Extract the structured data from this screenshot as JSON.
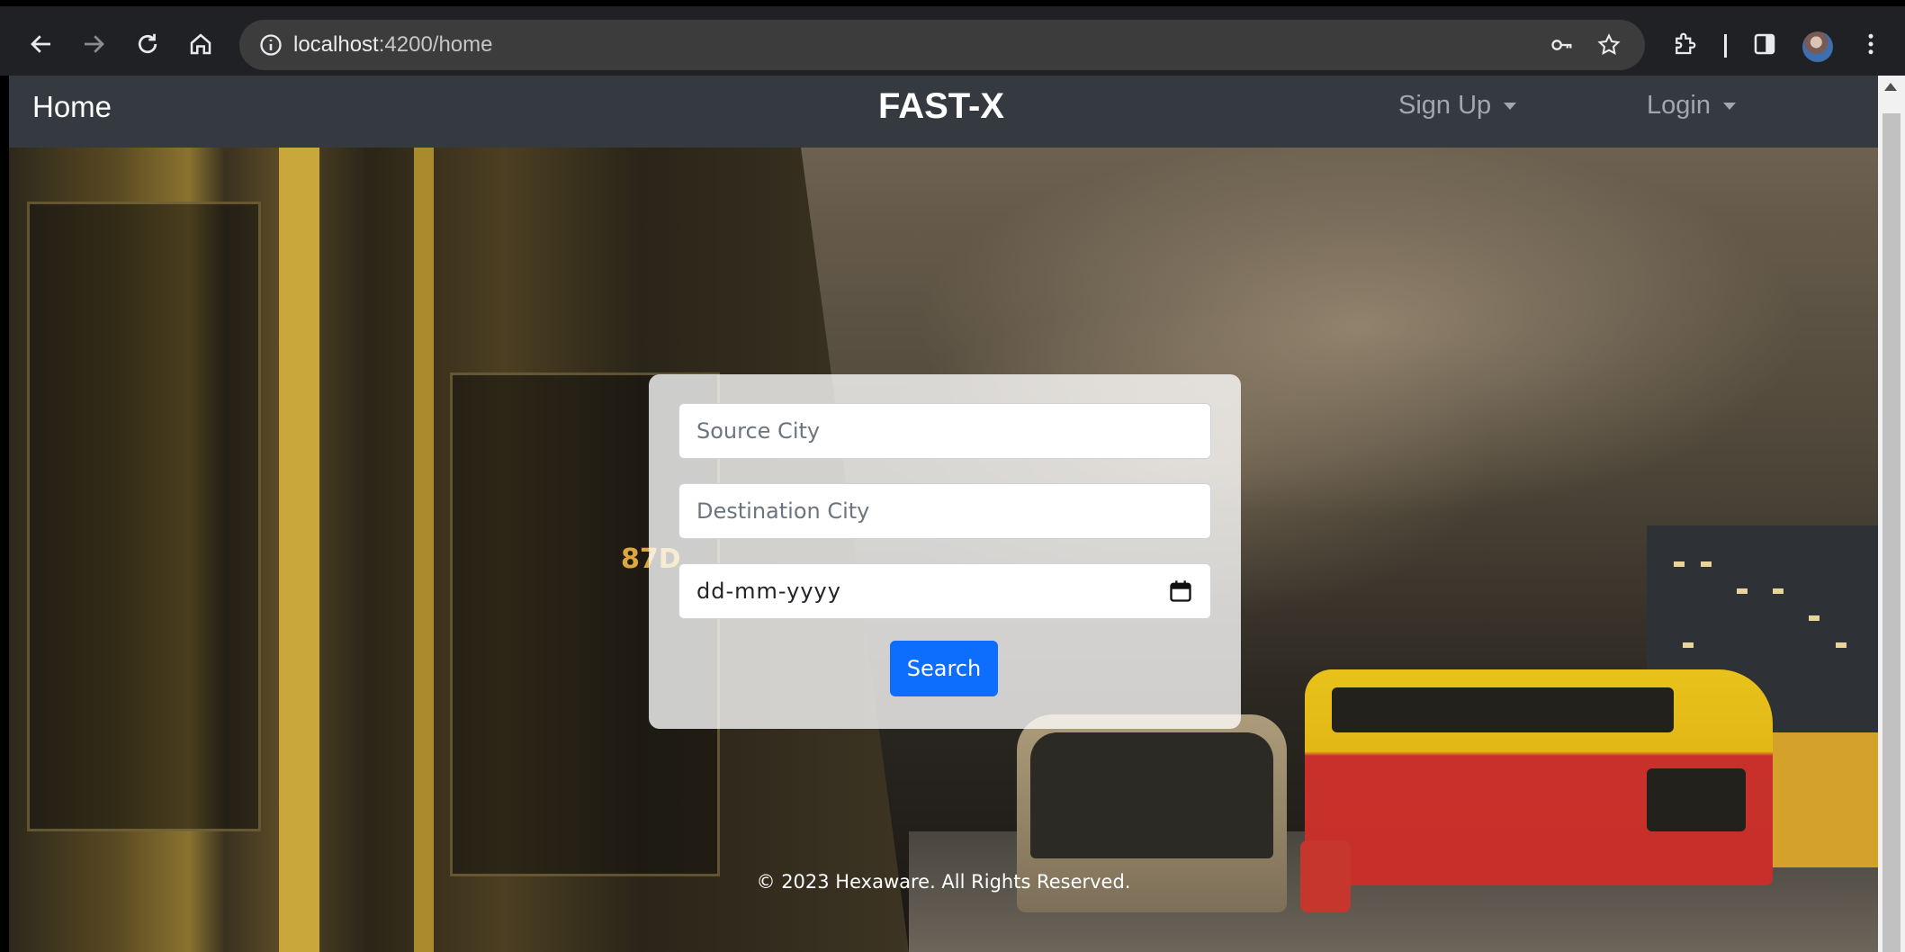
{
  "browser": {
    "url_host": "localhost",
    "url_path": ":4200/home",
    "icons": [
      "back-icon",
      "forward-icon",
      "reload-icon",
      "home-icon",
      "info-icon",
      "key-icon",
      "star-icon",
      "extensions-icon",
      "side-panel-icon",
      "avatar",
      "menu-icon"
    ]
  },
  "navbar": {
    "home_label": "Home",
    "brand": "FAST-X",
    "signup_label": "Sign Up",
    "login_label": "Login"
  },
  "search": {
    "source_placeholder": "Source City",
    "destination_placeholder": "Destination City",
    "date_placeholder": "dd-mm-yyyy",
    "button_label": "Search"
  },
  "footer": {
    "text": "© 2023 Hexaware. All Rights Reserved."
  },
  "colors": {
    "navbar_bg": "#343a40",
    "primary_button": "#0d6efd",
    "chrome_bg": "#202124"
  }
}
